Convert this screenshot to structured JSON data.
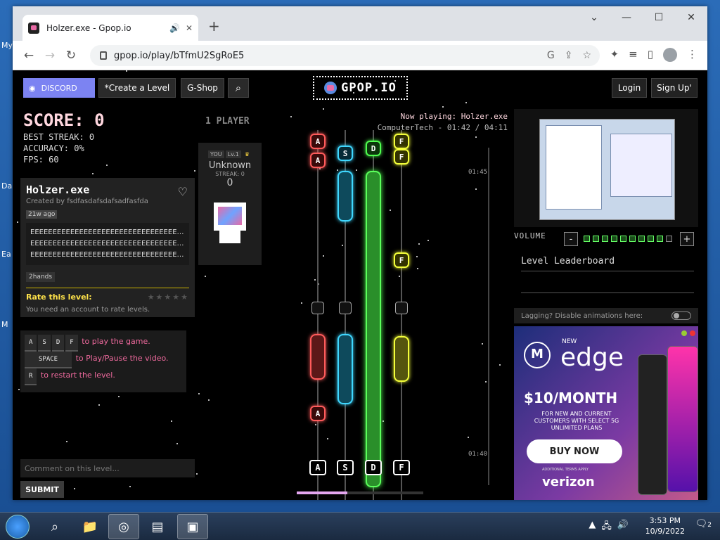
{
  "browser": {
    "tab_title": "Holzer.exe - Gpop.io",
    "url": "gpop.io/play/bTfmU2SgRoE5"
  },
  "desktop": {
    "icons": [
      "My",
      "Da",
      "Ea",
      "M"
    ]
  },
  "header": {
    "discord": "DISCORD",
    "create": "*Create a Level",
    "gshop": "G-Shop",
    "logo": "GPOP.IO",
    "login": "Login",
    "signup": "Sign Up'"
  },
  "stats": {
    "score": "SCORE: 0",
    "streak": "BEST STREAK: 0",
    "accuracy": "ACCURACY: 0%",
    "fps": "FPS: 60"
  },
  "level": {
    "title": "Holzer.exe",
    "creator": "Created by fsdfasdafsdafsadfasfda",
    "age": "21w ago",
    "desc_lines": [
      "EEEEEEEEEEEEEEEEEEEEEEEEEEEEEEEEEEEE",
      "EEEEEEEEEEEEEEEEEEEEEEEEEEEEEEEEEEEE",
      "EEEEEEEEEEEEEEEEEEEEEEEEEEEEEEEEEEEE..."
    ],
    "tag": "2hands",
    "rate_label": "Rate this level:",
    "rate_note": "You need an account to rate levels."
  },
  "controls": {
    "keys": [
      "A",
      "S",
      "D",
      "F"
    ],
    "keys_text": "to play the game.",
    "space": "SPACE",
    "space_text": "to Play/Pause the video.",
    "r": "R",
    "r_text": "to restart the level."
  },
  "comment": {
    "placeholder": "Comment on this level...",
    "submit": "SUBMIT"
  },
  "player": {
    "count": "1 PLAYER",
    "you": "YOU",
    "level": "Lv.1",
    "name": "Unknown",
    "streak": "STREAK: 0",
    "score": "0"
  },
  "now_playing": {
    "line1": "Now playing: Holzer.exe",
    "line2": "ComputerTech - 01:42 / 04:11"
  },
  "timeline": {
    "t1": "01:45",
    "t2": "01:40"
  },
  "lanes": [
    "A",
    "S",
    "D",
    "F"
  ],
  "progress": 0.4,
  "volume": {
    "label": "VOLUME",
    "minus": "-",
    "plus": "+",
    "level": 9,
    "max": 10
  },
  "leaderboard": {
    "title": "Level Leaderboard"
  },
  "lag": {
    "text": "Lagging? Disable animations here:"
  },
  "ad": {
    "new": "NEW",
    "brand": "edge",
    "price": "$10/MONTH",
    "sub": "FOR NEW AND CURRENT CUSTOMERS WITH SELECT 5G UNLIMITED PLANS",
    "cta": "BUY NOW",
    "fine": "ADDITIONAL TERMS APPLY",
    "carrier": "verizon"
  },
  "taskbar": {
    "time": "3:53 PM",
    "date": "10/9/2022",
    "notif_count": "2"
  },
  "colors": {
    "lane_a": "#ff5b5b",
    "lane_s": "#3fd7ff",
    "lane_d": "#4fff4f",
    "lane_f": "#f4ff3a",
    "discord": "#7c83f2"
  }
}
